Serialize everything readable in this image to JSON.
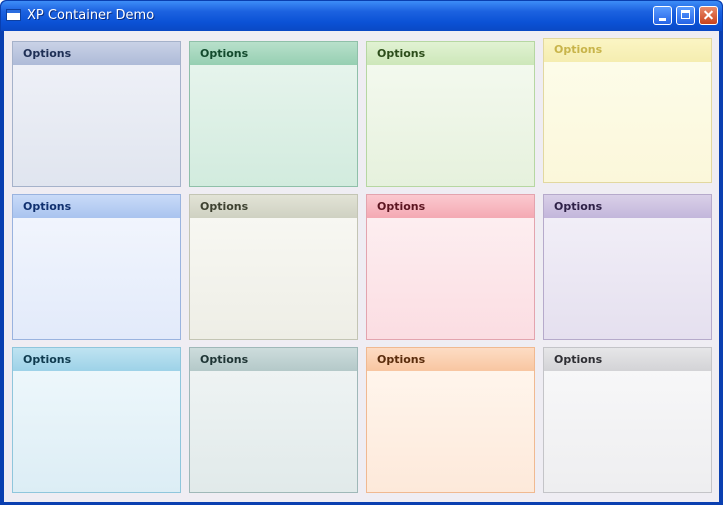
{
  "window": {
    "title": "XP Container Demo",
    "controls": [
      "minimize",
      "maximize",
      "close"
    ]
  },
  "panels": [
    {
      "label": "Options",
      "theme": "blue-gray"
    },
    {
      "label": "Options",
      "theme": "green"
    },
    {
      "label": "Options",
      "theme": "light-green"
    },
    {
      "label": "Options",
      "theme": "yellow"
    },
    {
      "label": "Options",
      "theme": "blue"
    },
    {
      "label": "Options",
      "theme": "olive"
    },
    {
      "label": "Options",
      "theme": "red"
    },
    {
      "label": "Options",
      "theme": "purple"
    },
    {
      "label": "Options",
      "theme": "teal"
    },
    {
      "label": "Options",
      "theme": "gray-teal"
    },
    {
      "label": "Options",
      "theme": "orange"
    },
    {
      "label": "Options",
      "theme": "silver"
    }
  ],
  "colors": {
    "titlebar": "#0b52d6",
    "client_background": "#efedf3"
  }
}
